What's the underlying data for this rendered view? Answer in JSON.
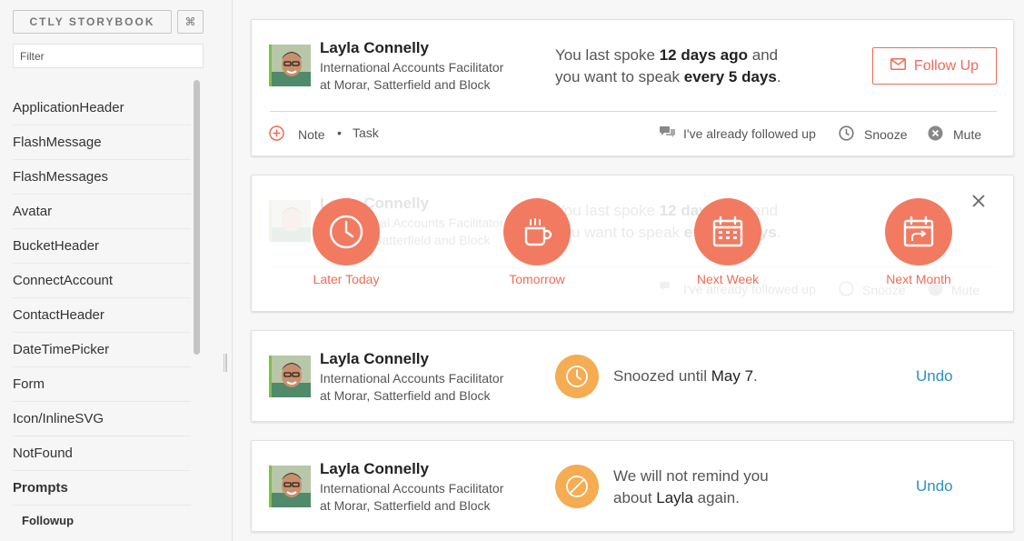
{
  "sidebar": {
    "title": "CTLY STORYBOOK",
    "shortcut": "⌘",
    "filter_placeholder": "Filter",
    "items": [
      {
        "label": "ApplicationHeader"
      },
      {
        "label": "FlashMessage"
      },
      {
        "label": "FlashMessages"
      },
      {
        "label": "Avatar"
      },
      {
        "label": "BucketHeader"
      },
      {
        "label": "ConnectAccount"
      },
      {
        "label": "ContactHeader"
      },
      {
        "label": "DateTimePicker"
      },
      {
        "label": "Form"
      },
      {
        "label": "Icon/InlineSVG"
      },
      {
        "label": "NotFound"
      },
      {
        "label": "Prompts"
      }
    ],
    "sub_item": "Followup"
  },
  "contact": {
    "name": "Layla Connelly",
    "title": "International Accounts Facilitator",
    "company": "at Morar, Satterfield and Block"
  },
  "card1": {
    "msg_a": "You last spoke ",
    "msg_a_bold": "12 days ago",
    "msg_a_end": " and",
    "msg_b": "you want to speak ",
    "msg_b_bold": "every 5 days",
    "msg_b_end": ".",
    "follow_up": "Follow Up",
    "note": "Note",
    "task": "Task",
    "already": "I've already followed up",
    "snooze": "Snooze",
    "mute": "Mute"
  },
  "snooze_options": [
    {
      "label": "Later Today",
      "icon": "clock-icon"
    },
    {
      "label": "Tomorrow",
      "icon": "coffee-icon"
    },
    {
      "label": "Next Week",
      "icon": "calendar-icon"
    },
    {
      "label": "Next Month",
      "icon": "calendar-forward-icon"
    }
  ],
  "card3": {
    "msg": "Snoozed until ",
    "date": "May 7",
    "end": ".",
    "undo": "Undo"
  },
  "card4": {
    "line1": "We will not remind you",
    "line2_a": "about ",
    "line2_bold": "Layla",
    "line2_end": " again.",
    "undo": "Undo"
  },
  "colors": {
    "accent": "#ef6c57",
    "snooze_bg": "#f27a61",
    "status": "#f5ac52",
    "link": "#2b8fcf"
  }
}
